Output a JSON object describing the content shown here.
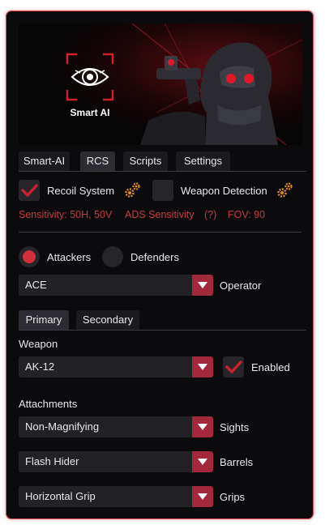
{
  "banner": {
    "brand": "Smart AI"
  },
  "main_tabs": [
    {
      "label": "Smart-AI",
      "active": false
    },
    {
      "label": "RCS",
      "active": true
    },
    {
      "label": "Scripts",
      "active": false
    },
    {
      "label": "Settings",
      "active": false
    }
  ],
  "rcs": {
    "recoil_system": {
      "label": "Recoil System",
      "checked": true
    },
    "weapon_detection": {
      "label": "Weapon Detection",
      "checked": false
    },
    "sensitivity": "Sensitivity: 50H, 50V",
    "ads_sensitivity": "ADS Sensitivity",
    "help": "(?)",
    "fov": "FOV: 90"
  },
  "side": {
    "attackers": {
      "label": "Attackers",
      "selected": true
    },
    "defenders": {
      "label": "Defenders",
      "selected": false
    }
  },
  "operator": {
    "value": "ACE",
    "label": "Operator"
  },
  "weapon_tabs": [
    {
      "label": "Primary",
      "active": true
    },
    {
      "label": "Secondary",
      "active": false
    }
  ],
  "weapon": {
    "section_label": "Weapon",
    "value": "AK-12",
    "enabled_label": "Enabled",
    "enabled": true
  },
  "attachments": {
    "section_label": "Attachments",
    "sights": {
      "value": "Non-Magnifying",
      "label": "Sights"
    },
    "barrels": {
      "value": "Flash Hider",
      "label": "Barrels"
    },
    "grips": {
      "value": "Horizontal Grip",
      "label": "Grips"
    }
  },
  "colors": {
    "accent": "#a3283a",
    "accent_text": "#c83a44",
    "gear": "#e08a1e",
    "border": "#e04a55"
  }
}
